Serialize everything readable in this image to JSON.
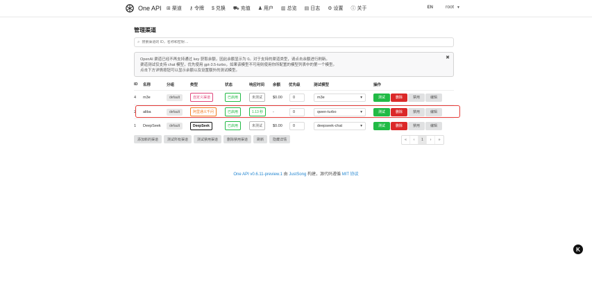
{
  "header": {
    "brand": "One API",
    "nav": [
      {
        "icon": "sitemap-icon",
        "glyph": "⊞",
        "label": "渠道"
      },
      {
        "icon": "key-icon",
        "glyph": "⚷",
        "label": "令牌"
      },
      {
        "icon": "dollar-icon",
        "glyph": "$",
        "label": "兑换"
      },
      {
        "icon": "cart-icon",
        "glyph": "⛟",
        "label": "充值"
      },
      {
        "icon": "user-icon",
        "glyph": "♟",
        "label": "用户"
      },
      {
        "icon": "chart-icon",
        "glyph": "▥",
        "label": "总览"
      },
      {
        "icon": "book-icon",
        "glyph": "▤",
        "label": "日志"
      },
      {
        "icon": "gear-icon",
        "glyph": "⚙",
        "label": "设置"
      },
      {
        "icon": "info-icon",
        "glyph": "ⓘ",
        "label": "关于"
      }
    ],
    "lang": "EN",
    "user": "root"
  },
  "main": {
    "title": "管理渠道",
    "search_placeholder": "搜索渠道的 ID，名称和密钥 ...",
    "notice": {
      "lines": [
        "OpenAI 渠道已经不再支持通过 key 获取余额，因此余额显示为 0。对于支持的渠道类型，请点击余额进行刷新。",
        "渠道测试仅支持 chat 模型，优先使用 gpt-3.5-turbo，如果该模型不可用则使用你所配置的模型列表中的第一个模型。",
        "点击下方详情按钮可以显示余额以及设置额外的测试模型。"
      ]
    },
    "columns": [
      "ID",
      "名称",
      "分组",
      "类型",
      "状态",
      "响应时间",
      "余额",
      "优先级",
      "测试模型",
      "操作"
    ],
    "rows": [
      {
        "id": "4",
        "name": "m3e",
        "group": "default",
        "type": "自定义渠道",
        "status": "已启用",
        "resp": "未测试",
        "balance": "$0.00",
        "priority": "0",
        "model": "m3e"
      },
      {
        "id": "2",
        "name": "aliba",
        "group": "default",
        "type": "阿里通义千问",
        "status": "已启用",
        "resp": "1.13 秒",
        "balance": "-",
        "priority": "0",
        "model": "qwen-turbo"
      },
      {
        "id": "1",
        "name": "DeepSeek",
        "group": "default",
        "type": "DeepSeek",
        "status": "已启用",
        "resp": "未测试",
        "balance": "$0.00",
        "priority": "0",
        "model": "deepseek-chat"
      }
    ],
    "actions": {
      "test": "测试",
      "delete": "删除",
      "disable": "禁用",
      "edit": "编辑"
    },
    "footer_buttons": [
      "添加新的渠道",
      "测试所有渠道",
      "测试禁用渠道",
      "删除禁用渠道",
      "刷新",
      "隐藏详情"
    ],
    "pager": [
      "«",
      "‹",
      "1",
      "›",
      "»"
    ]
  },
  "credits": {
    "version": "One API v0.6.11-preview.1",
    "mid": " 由 ",
    "author": "JustSong",
    "mid2": " 构建，源代码遵循 ",
    "license": "MIT 协议"
  }
}
